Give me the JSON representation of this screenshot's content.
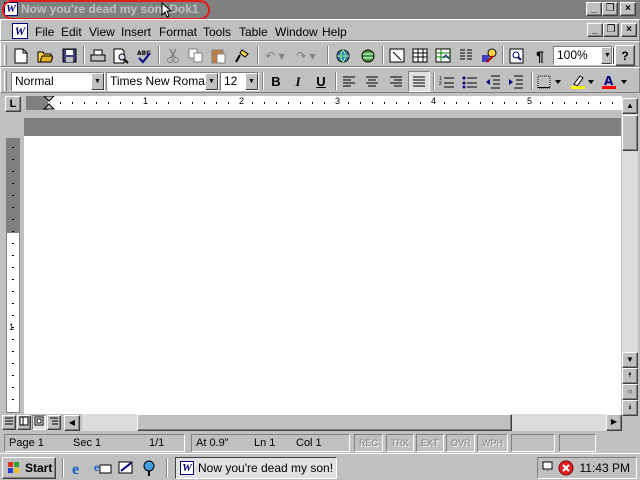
{
  "window": {
    "title": "Now you're dead my son! Dok1"
  },
  "menu": [
    "File",
    "Edit",
    "View",
    "Insert",
    "Format",
    "Tools",
    "Table",
    "Window",
    "Help"
  ],
  "standard_toolbar": {
    "zoom": "100%",
    "help_label": "?"
  },
  "formatting_toolbar": {
    "style": "Normal",
    "font": "Times New Roman",
    "size": "12",
    "bold": "B",
    "italic": "I",
    "underline": "U",
    "font_color_label": "A"
  },
  "ruler": {
    "numbers": [
      "1",
      "2",
      "3",
      "4",
      "5"
    ],
    "vertical_number": "1",
    "tab_label": "L"
  },
  "status": {
    "page": "Page 1",
    "section": "Sec 1",
    "pages": "1/1",
    "at": "At 0.9\"",
    "line": "Ln 1",
    "col": "Col 1",
    "rec": "REC",
    "trk": "TRK",
    "ext": "EXT",
    "ovr": "OVR",
    "wph": "WPH"
  },
  "taskbar": {
    "start": "Start",
    "task": "Now you're dead my son! -...",
    "clock": "11:43 PM"
  },
  "colors": {
    "title_inactive": "#808080",
    "oval": "#e21d1d",
    "highlight": "#ffff00",
    "font_color": "#ff0000"
  }
}
